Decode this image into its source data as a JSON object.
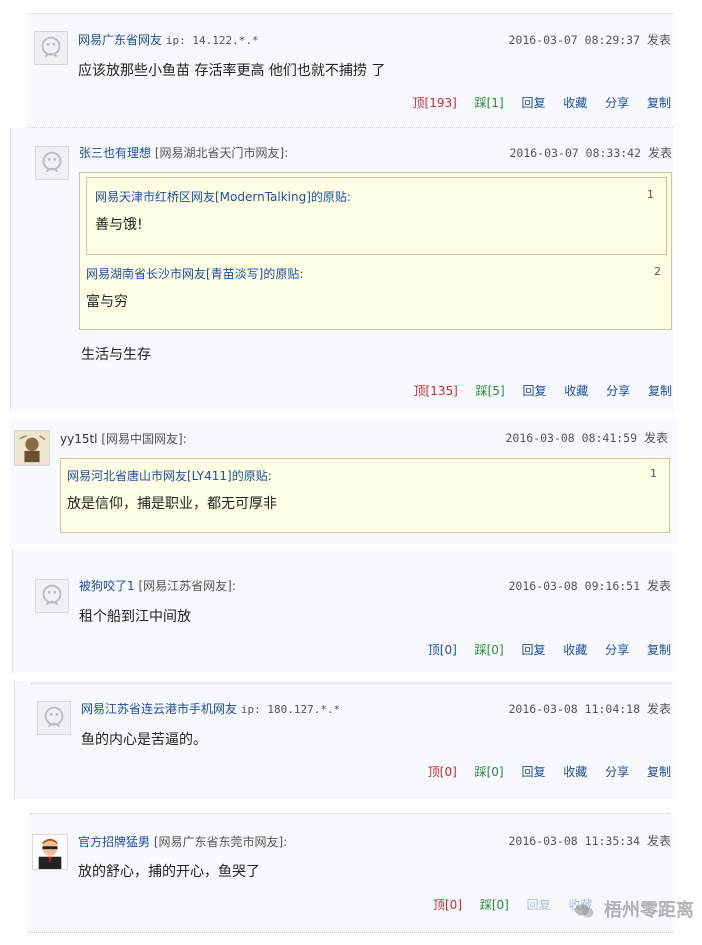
{
  "comments": [
    {
      "user": "网易广东省网友",
      "location": "",
      "ip": "ip: 14.122.*.*",
      "time": "2016-03-07 08:29:37",
      "posted_label": "发表",
      "text": "应该放那些小鱼苗 存活率更高 他们也就不捕捞 了",
      "actions": {
        "up": "顶[193]",
        "down": "踩[1]",
        "reply": "回复",
        "fav": "收藏",
        "share": "分享",
        "copy": "复制"
      }
    },
    {
      "user": "张三也有理想",
      "location": "[网易湖北省天门市网友]:",
      "time": "2016-03-07 08:33:42",
      "posted_label": "发表",
      "quotes": [
        {
          "head": "网易天津市红桥区网友[ModernTalking]的原贴:",
          "num": "1",
          "text": "善与饿!"
        },
        {
          "head": "网易湖南省长沙市网友[青苗淡写]的原贴:",
          "num": "2",
          "text": "富与穷"
        }
      ],
      "text": "生活与生存",
      "actions": {
        "up": "顶[135]",
        "down": "踩[5]",
        "reply": "回复",
        "fav": "收藏",
        "share": "分享",
        "copy": "复制"
      }
    },
    {
      "user": "yy15tl",
      "location": "[网易中国网友]:",
      "time": "2016-03-08 08:41:59",
      "posted_label": "发表",
      "quotes": [
        {
          "head": "网易河北省唐山市网友[LY411]的原贴:",
          "num": "1",
          "text": "放是信仰，捕是职业，都无可厚非"
        }
      ]
    },
    {
      "user": "被狗咬了1",
      "location": "[网易江苏省网友]:",
      "time": "2016-03-08 09:16:51",
      "posted_label": "发表",
      "text": "租个船到江中间放",
      "actions": {
        "up": "顶[0]",
        "down": "踩[0]",
        "reply": "回复",
        "fav": "收藏",
        "share": "分享",
        "copy": "复制"
      }
    },
    {
      "user": "网易江苏省连云港市手机网友",
      "location": "",
      "ip": "ip: 180.127.*.*",
      "time": "2016-03-08 11:04:18",
      "posted_label": "发表",
      "text": "鱼的内心是苦逼的。",
      "actions": {
        "up": "顶[0]",
        "down": "踩[0]",
        "reply": "回复",
        "fav": "收藏",
        "share": "分享",
        "copy": "复制"
      }
    },
    {
      "user": "官方招牌猛男",
      "location": "[网易广东省东莞市网友]:",
      "time": "2016-03-08 11:35:34",
      "posted_label": "发表",
      "text": "放的舒心，捕的开心，鱼哭了",
      "actions": {
        "up": "顶[0]",
        "down": "踩[0]",
        "reply": "回复",
        "fav": "收藏"
      }
    }
  ],
  "watermark": "梧州零距离",
  "colors": {
    "link": "#1f4fa0",
    "up": "#cc2a2a",
    "down": "#2a8a3a",
    "quote_bg": "#ffffe6",
    "card_bg": "#f7f9fe"
  },
  "icons": {
    "default_avatar": "default-avatar-icon",
    "photo_avatar": "user-photo-avatar",
    "wechat": "wechat-icon"
  }
}
